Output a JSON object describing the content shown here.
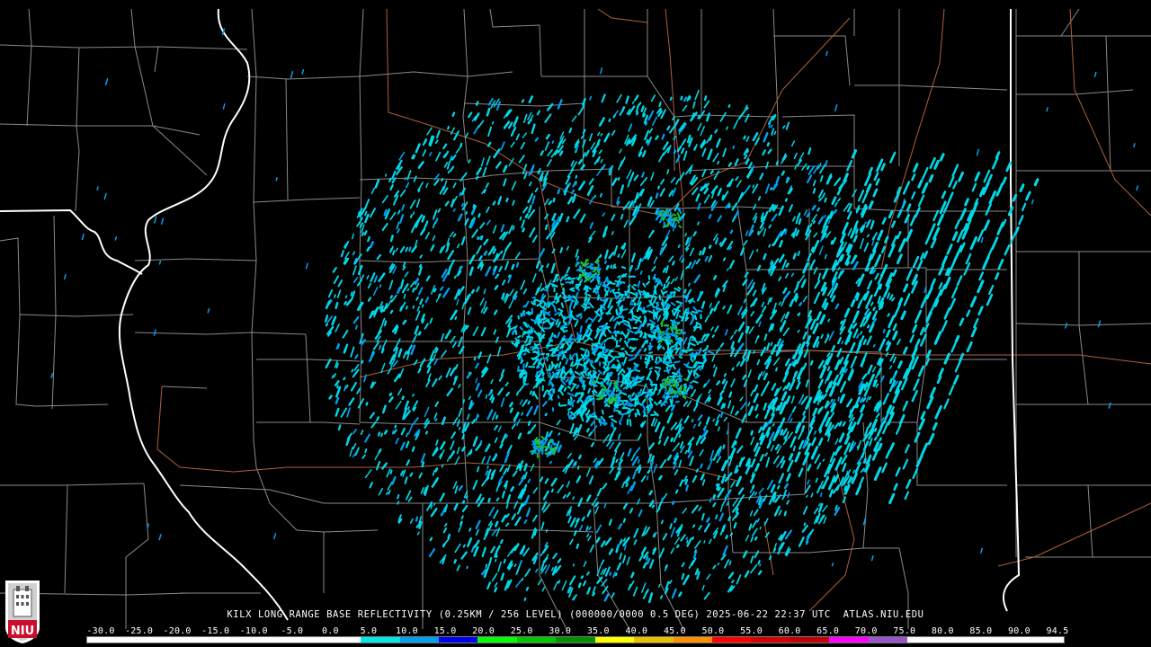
{
  "title": "KILX LONG RANGE BASE REFLECTIVITY (0.25KM / 256 LEVEL) (000000/0000 0.5 DEG) 2025-06-22 22:37 UTC  ATLAS.NIU.EDU",
  "logo_text": "NIU",
  "scale": {
    "labels": [
      "-30.0",
      "-25.0",
      "-20.0",
      "-15.0",
      "-10.0",
      "-5.0",
      "0.0",
      "5.0",
      "10.0",
      "15.0",
      "20.0",
      "25.0",
      "30.0",
      "35.0",
      "40.0",
      "45.0",
      "50.0",
      "55.0",
      "60.0",
      "65.0",
      "70.0",
      "75.0",
      "80.0",
      "85.0",
      "90.0",
      "94.5"
    ],
    "colors": [
      "#ffffff",
      "#ffffff",
      "#ffffff",
      "#ffffff",
      "#ffffff",
      "#ffffff",
      "#ffffff",
      "#00e8e8",
      "#00a0f0",
      "#0000f0",
      "#00ff00",
      "#00c800",
      "#009000",
      "#ffff00",
      "#e7c000",
      "#ff9000",
      "#ff0000",
      "#d60000",
      "#c00000",
      "#ff00ff",
      "#9955c9",
      "#ffffff",
      "#ffffff",
      "#ffffff",
      "#ffffff"
    ]
  },
  "colors": {
    "background": "#000000",
    "county_lines": "#8a8a8a",
    "state_lines": "#ffffff",
    "highways": "#b0603a",
    "echo_primary": "#00d8e8",
    "echo_secondary": "#00a0f0",
    "echo_strong": "#22c02a"
  }
}
